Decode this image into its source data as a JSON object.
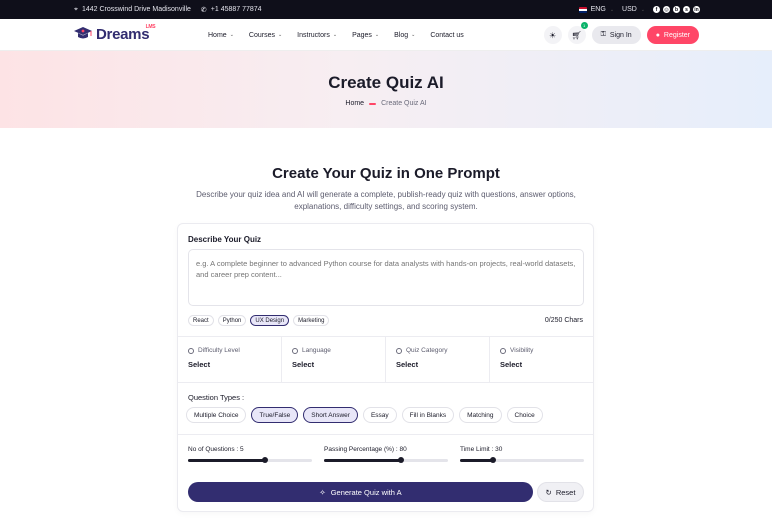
{
  "topbar": {
    "address": "1442 Crosswind Drive Madisonville",
    "phone": "+1 45887 77874",
    "language": "ENG",
    "currency": "USD",
    "social": [
      "facebook-icon",
      "instagram-icon",
      "behance-icon",
      "skype-icon",
      "linkedin-icon"
    ]
  },
  "brand": {
    "name": "Dreams",
    "sup": "LMS"
  },
  "nav": {
    "items": [
      {
        "label": "Home"
      },
      {
        "label": "Courses"
      },
      {
        "label": "Instructors"
      },
      {
        "label": "Pages"
      },
      {
        "label": "Blog"
      },
      {
        "label": "Contact us"
      }
    ],
    "cart_count": "1",
    "signin_label": "Sign In",
    "register_label": "Register"
  },
  "hero": {
    "title": "Create Quiz AI",
    "breadcrumb_home": "Home",
    "breadcrumb_current": "Create Quiz AI"
  },
  "main": {
    "title": "Create Your Quiz in One Prompt",
    "description": "Describe your quiz idea and AI will generate a complete, publish-ready quiz with questions, answer options, explanations, difficulty settings, and scoring system."
  },
  "form": {
    "title": "Describe Your Quiz",
    "placeholder": "e.g. A complete beginner to advanced Python course for data analysts with hands-on projects, real-world datasets, and career prep content...",
    "tags": [
      {
        "label": "React",
        "active": false
      },
      {
        "label": "Python",
        "active": false
      },
      {
        "label": "UX Design",
        "active": true
      },
      {
        "label": "Marketing",
        "active": false
      }
    ],
    "char_count": "0/250 Chars",
    "selects": [
      {
        "label": "Difficulty Level",
        "value": "Select"
      },
      {
        "label": "Language",
        "value": "Select"
      },
      {
        "label": "Quiz Category",
        "value": "Select"
      },
      {
        "label": "Visibility",
        "value": "Select"
      }
    ],
    "question_types_label": "Question Types :",
    "question_types": [
      {
        "label": "Multiple Choice",
        "active": false
      },
      {
        "label": "True/False",
        "active": true
      },
      {
        "label": "Short Answer",
        "active": true
      },
      {
        "label": "Essay",
        "active": false
      },
      {
        "label": "Fill in Blanks",
        "active": false
      },
      {
        "label": "Matching",
        "active": false
      },
      {
        "label": "Choice",
        "active": false
      }
    ],
    "sliders": [
      {
        "label": "No of Questions : 5",
        "fraction": 0.62
      },
      {
        "label": "Passing Percentage (%) : 80",
        "fraction": 0.62
      },
      {
        "label": "Time Limit : 30",
        "fraction": 0.27
      }
    ],
    "generate_label": "Generate Quiz with A",
    "reset_label": "Reset"
  }
}
